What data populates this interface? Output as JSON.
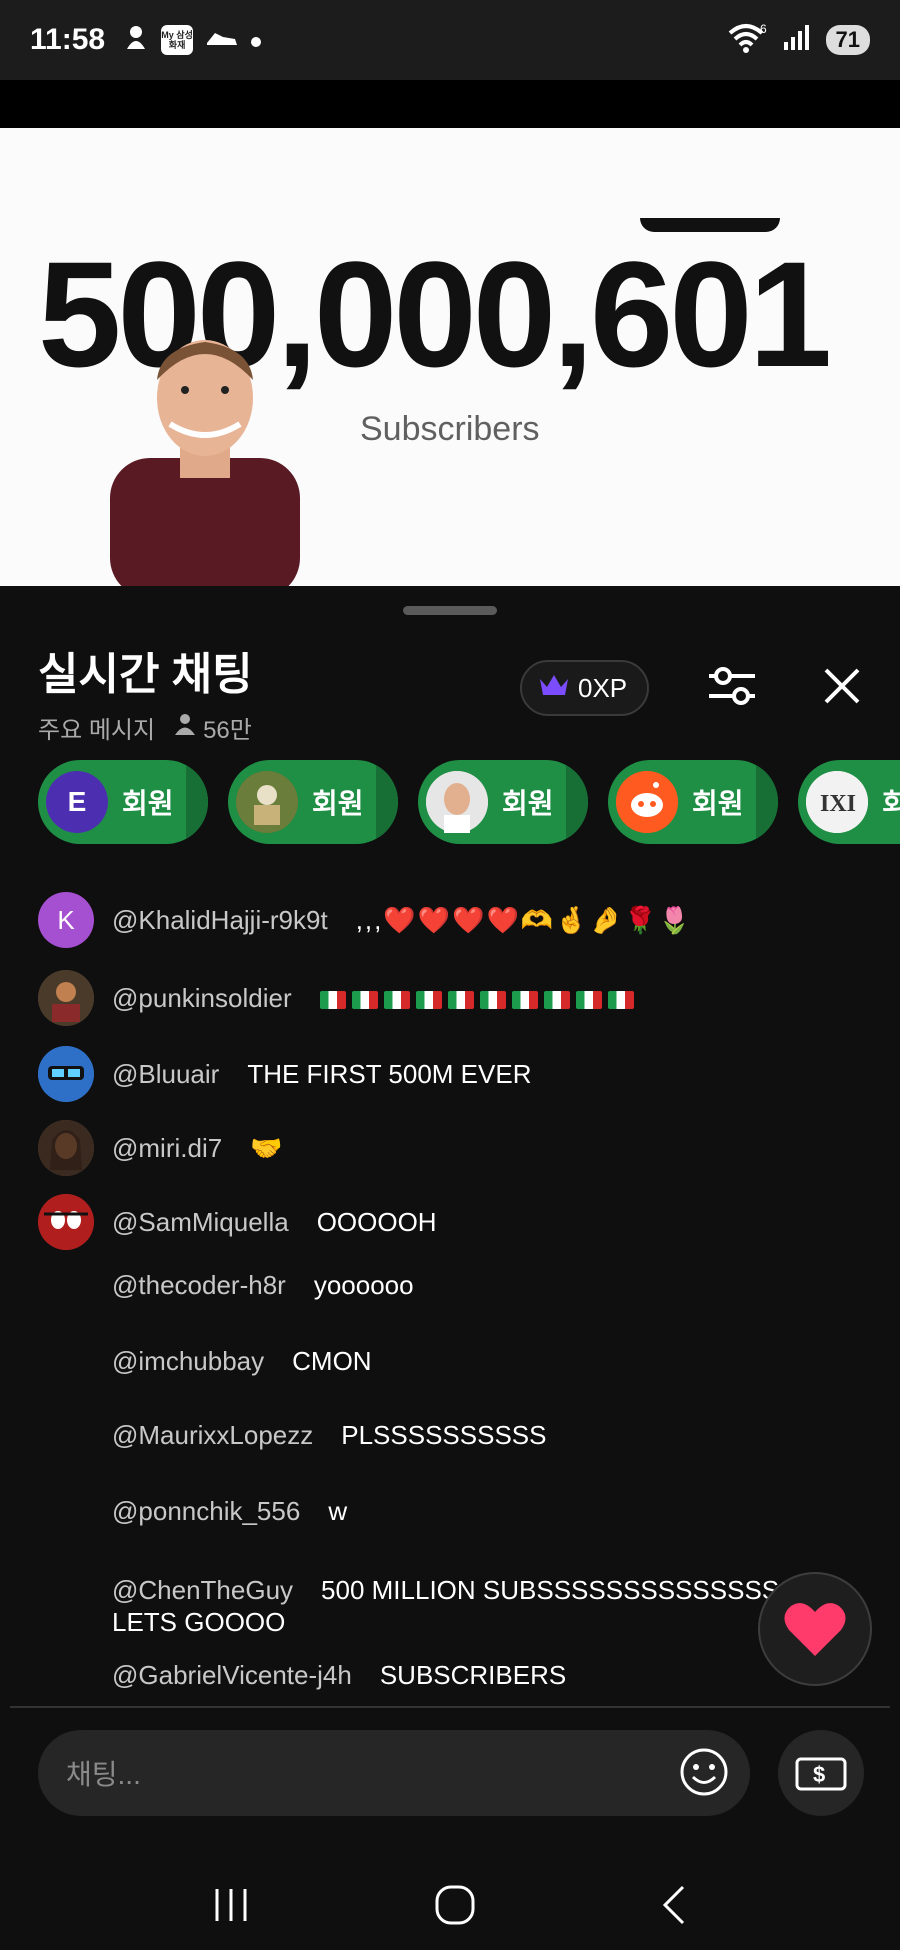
{
  "status_bar": {
    "time": "11:58",
    "app_badge_text": "My 삼성화재",
    "battery": "71",
    "wifi_badge": "6"
  },
  "video": {
    "subscriber_count": "500,000,601",
    "label": "Subscribers"
  },
  "chat": {
    "title": "실시간 채팅",
    "mode": "주요 메시지",
    "viewers": "56만",
    "xp": "0XP",
    "member_chips": [
      {
        "initial": "E",
        "label": "회원",
        "color": "#4c2fb0"
      },
      {
        "initial": "",
        "label": "회원",
        "color": "#556b2f"
      },
      {
        "initial": "",
        "label": "회원",
        "color": "#d6d6d6"
      },
      {
        "initial": "",
        "label": "회원",
        "color": "#ff5a1f"
      },
      {
        "initial": "",
        "label": "회",
        "color": "#ffffff"
      }
    ],
    "messages": [
      {
        "avatar_initial": "K",
        "avatar_color": "#a54fd1",
        "author": "@KhalidHajji-r9k9t",
        "text": ",,,❤️❤️❤️❤️🫶🤞🤌🌹🌷"
      },
      {
        "avatar_initial": "",
        "avatar_color": "#5a4a3a",
        "author": "@punkinsoldier",
        "text": ""
      },
      {
        "avatar_initial": "",
        "avatar_color": "#3b7fd1",
        "author": "@Bluuair",
        "text": "THE FIRST 500M EVER"
      },
      {
        "avatar_initial": "",
        "avatar_color": "#6b4a35",
        "author": "@miri.di7",
        "text": "🤝"
      },
      {
        "avatar_initial": "",
        "avatar_color": "#c02828",
        "author": "@SamMiquella",
        "text": "OOOOOH"
      },
      {
        "author": "@thecoder-h8r",
        "text": "yoooooo"
      },
      {
        "author": "@imchubbay",
        "text": "CMON"
      },
      {
        "author": "@MaurixxLopezz",
        "text": "PLSSSSSSSSSS"
      },
      {
        "author": "@ponnchik_556",
        "text": "w"
      },
      {
        "author": "@ChenTheGuy",
        "text": "500 MILLION SUBSSSSSSSSSSSSSSS LETS GOOOO"
      },
      {
        "author": "@GabrielVicente-j4h",
        "text": "SUBSCRIBERS"
      }
    ],
    "input_placeholder": "채팅..."
  }
}
